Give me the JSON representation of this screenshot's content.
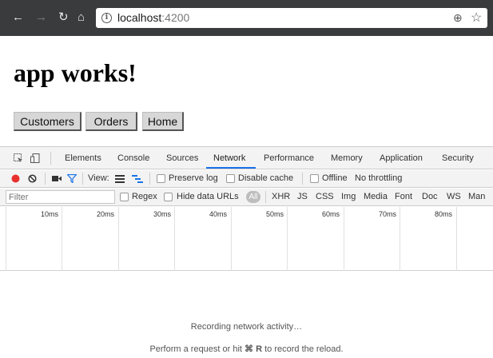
{
  "browser": {
    "url_host": "localhost",
    "url_port": ":4200",
    "icons": [
      "back-arrow-icon",
      "forward-arrow-icon",
      "reload-icon",
      "home-icon",
      "info-icon",
      "zoom-icon",
      "star-icon"
    ]
  },
  "page": {
    "title": "app works!",
    "nav_buttons": [
      "Customers",
      "Orders",
      "Home"
    ]
  },
  "devtools": {
    "tabs": [
      "Elements",
      "Console",
      "Sources",
      "Network",
      "Performance",
      "Memory",
      "Application",
      "Security"
    ],
    "active_tab": "Network",
    "toolbar": {
      "view_label": "View:",
      "preserve_log": "Preserve log",
      "disable_cache": "Disable cache",
      "offline": "Offline",
      "throttling": "No throttling"
    },
    "filter": {
      "placeholder": "Filter",
      "regex": "Regex",
      "hide_data_urls": "Hide data URLs",
      "all": "All",
      "types": [
        "XHR",
        "JS",
        "CSS",
        "Img",
        "Media",
        "Font",
        "Doc",
        "WS",
        "Man"
      ]
    },
    "timeline_labels": [
      "10ms",
      "20ms",
      "30ms",
      "40ms",
      "50ms",
      "60ms",
      "70ms",
      "80ms"
    ],
    "empty_state": {
      "line1": "Recording network activity…",
      "line2_prefix": "Perform a request or hit ",
      "line2_key": "⌘ R",
      "line2_suffix": " to record the reload."
    },
    "colors": {
      "record_red": "#e8312f",
      "filter_blue": "#1a73e8",
      "active_underline": "#1a73e8"
    }
  }
}
